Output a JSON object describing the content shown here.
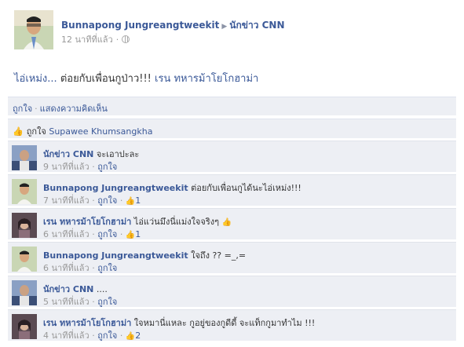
{
  "post": {
    "author": "Bunnapong Jungreangtweekit",
    "target": "นักข่าว CNN",
    "time": "12 นาทีที่แล้ว",
    "text_tag": "ไอ่เหม่ง...",
    "text_plain": " ต่อยกับเพื่อนกูป่าว!!!",
    "text_tag2": "เรน ทหารม้าโยโกฮาม่า"
  },
  "actions": {
    "like": "ถูกใจ",
    "comment": "แสดงความคิดเห็น"
  },
  "likes": {
    "label": "ถูกใจ",
    "who": "Supawee Khumsangkha"
  },
  "comments": [
    {
      "name": "นักข่าว CNN",
      "text": "จะเอาปะละ",
      "time": "9 นาทีที่แล้ว",
      "like": "ถูกใจ",
      "likes": ""
    },
    {
      "name": "Bunnapong Jungreangtweekit",
      "text": "ต่อยกับเพื่อนกูได้นะไอ่เหม่ง!!!",
      "time": "7 นาทีที่แล้ว",
      "like": "ถูกใจ",
      "likes": "1"
    },
    {
      "name": "เรน ทหารม้าโยโกฮาม่า",
      "text": "ไอ่แว่นมึงนี่แม่งใจจริงๆ",
      "time": "6 นาทีที่แล้ว",
      "like": "ถูกใจ",
      "likes": "1"
    },
    {
      "name": "Bunnapong Jungreangtweekit",
      "text": "ใจถึง ?? =_,=",
      "time": "6 นาทีที่แล้ว",
      "like": "ถูกใจ",
      "likes": ""
    },
    {
      "name": "นักข่าว CNN",
      "text": "....",
      "time": "5 นาทีที่แล้ว",
      "like": "ถูกใจ",
      "likes": ""
    },
    {
      "name": "เรน ทหารม้าโยโกฮาม่า",
      "text": "ใจหมานี่แหละ กูอยู่ของกูดีดี้ จะแท็กกูมาทำไม !!!",
      "time": "4 นาทีที่แล้ว",
      "like": "ถูกใจ",
      "likes": "2"
    }
  ],
  "icons": {
    "globe": "globe-icon",
    "thumb": "thumbs-up-icon"
  },
  "colors": {
    "link": "#3b5998",
    "panel": "#edeff4",
    "muted": "#999999"
  }
}
